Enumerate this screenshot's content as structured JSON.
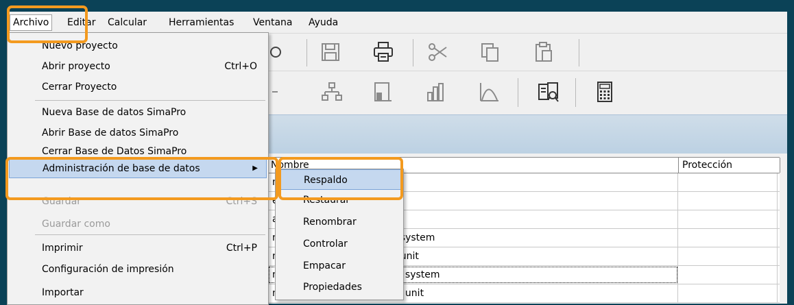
{
  "menubar": {
    "items": [
      {
        "label": "Archivo"
      },
      {
        "label": "Editar"
      },
      {
        "label": "Calcular"
      },
      {
        "label": "Herramientas"
      },
      {
        "label": "Ventana"
      },
      {
        "label": "Ayuda"
      }
    ]
  },
  "toolbar": {
    "row1_icons": [
      "new-icon",
      "save-icon",
      "print-icon",
      "cut-icon",
      "copy-icon",
      "paste-icon"
    ],
    "row2_icons": [
      "tree-icon",
      "network-icon",
      "fill-chart-icon",
      "bar-chart-icon",
      "curve-icon",
      "compare-document-icon",
      "calculator-icon"
    ]
  },
  "file_menu": {
    "items": [
      {
        "label": "Nuevo proyecto",
        "shortcut": "",
        "disabled": false
      },
      {
        "label": "Abrir proyecto",
        "shortcut": "Ctrl+O",
        "disabled": false
      },
      {
        "label": "Cerrar Proyecto",
        "shortcut": "",
        "disabled": false
      },
      {
        "label": "Nueva Base de datos SimaPro",
        "shortcut": "",
        "disabled": false
      },
      {
        "label": "Abrir Base de datos SimaPro",
        "shortcut": "",
        "disabled": false
      },
      {
        "label": "Cerrar Base de Datos SimaPro",
        "shortcut": "",
        "disabled": false
      },
      {
        "label": "Administración de base de datos",
        "shortcut": "",
        "disabled": false,
        "submenu": true
      },
      {
        "label": "Guardar",
        "shortcut": "Ctrl+S",
        "disabled": true
      },
      {
        "label": "Guardar como",
        "shortcut": "",
        "disabled": true
      },
      {
        "label": "Imprimir",
        "shortcut": "Ctrl+P",
        "disabled": false
      },
      {
        "label": "Configuración de impresión",
        "shortcut": "",
        "disabled": false
      },
      {
        "label": "Importar",
        "shortcut": "",
        "disabled": false
      }
    ]
  },
  "submenu": {
    "items": [
      {
        "label": "Respaldo"
      },
      {
        "label": "Restaurar"
      },
      {
        "label": "Renombrar"
      },
      {
        "label": "Controlar"
      },
      {
        "label": "Empacar"
      },
      {
        "label": "Propiedades"
      }
    ]
  },
  "table": {
    "columns": [
      "Nombre",
      "Protección"
    ],
    "rows": [
      {
        "name": "mic allocation",
        "protection": ""
      },
      {
        "name": "energy allocation",
        "protection": ""
      },
      {
        "name": "allocation",
        "protection": ""
      },
      {
        "name": "n at point of substitution - system",
        "protection": ""
      },
      {
        "name": "n at point of substitution - unit",
        "protection": ""
      },
      {
        "name": "n, cut-off by classification - system",
        "protection": ""
      },
      {
        "name": "n, cut-off by classification - unit",
        "protection": ""
      }
    ]
  },
  "colors": {
    "background": "#0b4257",
    "highlight_outline": "#f39a1f",
    "menu_selection": "#c5d8ef"
  }
}
